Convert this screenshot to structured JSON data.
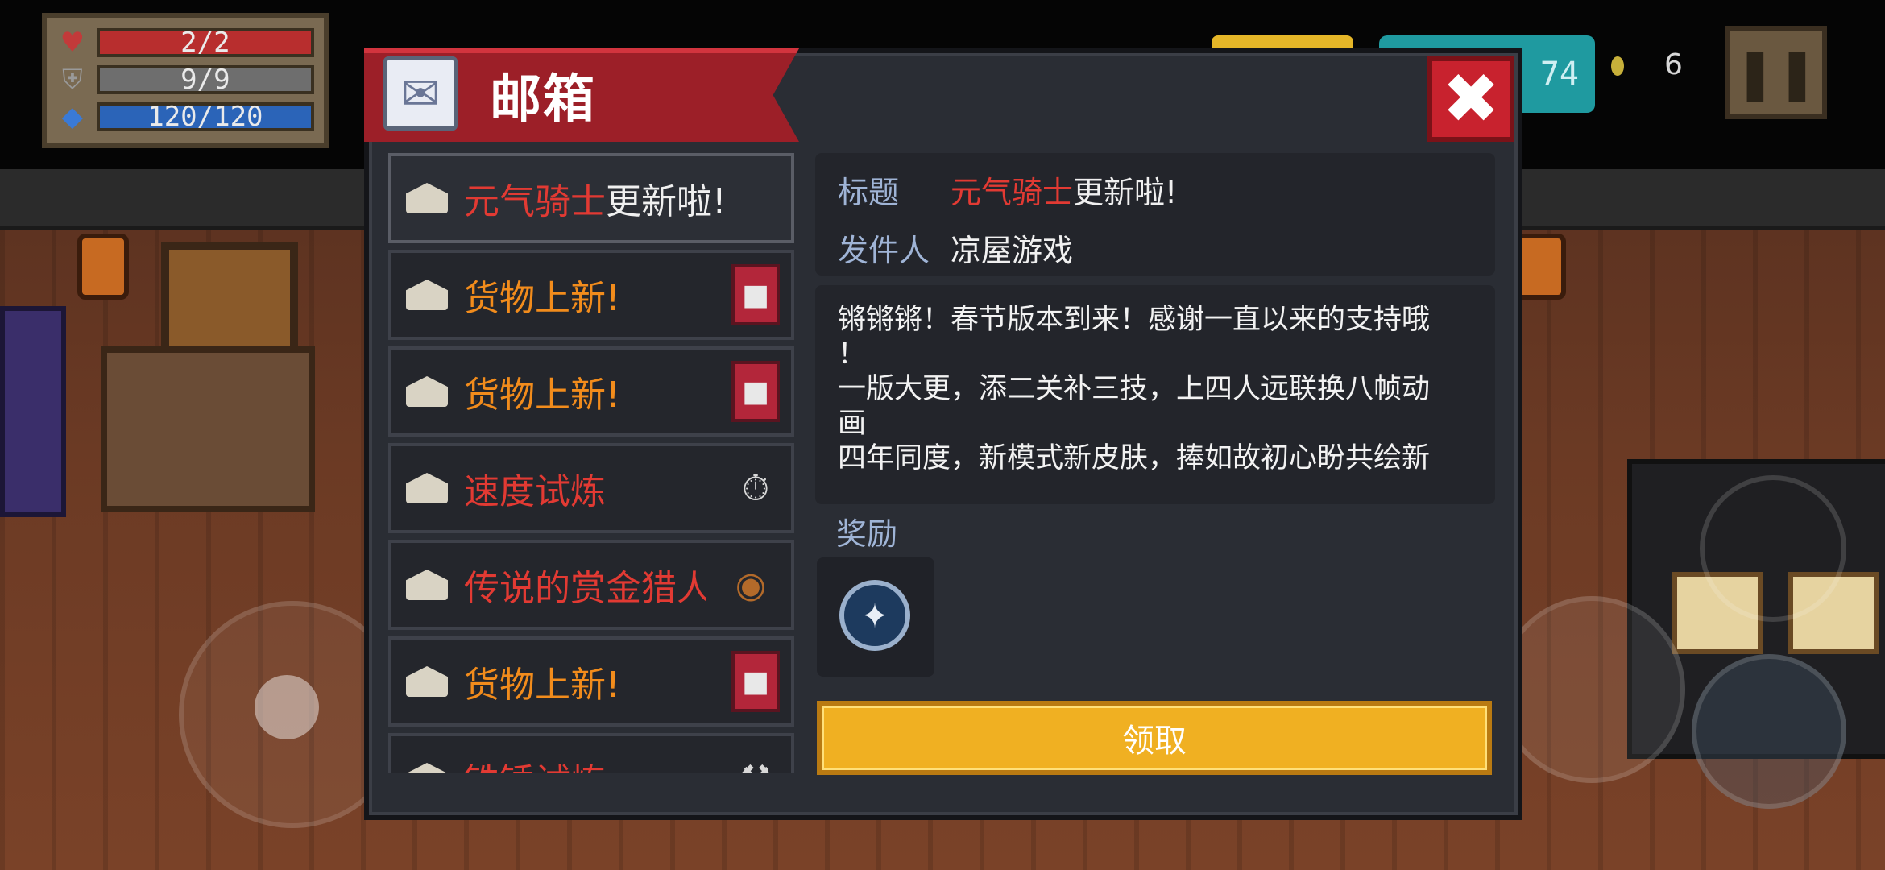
{
  "hud": {
    "hp": "2/2",
    "armor": "9/9",
    "energy": "120/120",
    "gems_partial": "74",
    "coins": "6",
    "hp_icon": "heart-icon",
    "armor_icon": "shield-icon",
    "energy_icon": "diamond-icon",
    "pause_icon": "pause-icon"
  },
  "mailbox": {
    "title": "邮箱",
    "close_icon": "close-icon",
    "mails": [
      {
        "title_highlight": "元气骑士",
        "title_rest": "更新啦!",
        "highlight_color": "red",
        "thumb": "",
        "selected": true
      },
      {
        "title_highlight": "货物上新!",
        "title_rest": "",
        "highlight_color": "orange",
        "thumb": "cat-merchant-icon"
      },
      {
        "title_highlight": "货物上新!",
        "title_rest": "",
        "highlight_color": "orange",
        "thumb": "cat-merchant-icon"
      },
      {
        "title_highlight": "速度试炼",
        "title_rest": "",
        "highlight_color": "red",
        "thumb": "stopwatch-icon"
      },
      {
        "title_highlight": "传说的赏金猎人",
        "title_rest": "",
        "highlight_color": "red",
        "thumb": "bounty-hunter-icon"
      },
      {
        "title_highlight": "货物上新!",
        "title_rest": "",
        "highlight_color": "orange",
        "thumb": "cat-merchant-icon"
      },
      {
        "title_highlight": "铁锤试炼",
        "title_rest": "",
        "highlight_color": "red",
        "thumb": "hammer-icon"
      }
    ],
    "detail": {
      "subject_label": "标题",
      "subject_highlight": "元气骑士",
      "subject_rest": "更新啦!",
      "sender_label": "发件人",
      "sender": "凉屋游戏",
      "body_line1": "锵锵锵！春节版本到来！感谢一直以来的支持哦",
      "body_line2": "！",
      "body_line3": "一版大更，添二关补三技，上四人远联换八帧动",
      "body_line4": "画",
      "body_line5": "四年同度，新模式新皮肤，捧如故初心盼共绘新",
      "reward_label": "奖励",
      "reward_icon": "fish-icon",
      "claim_label": "领取"
    }
  },
  "colors": {
    "banner": "#9c1f28",
    "highlight_red": "#e23a33",
    "highlight_orange": "#f28c1c",
    "claim": "#f0b022"
  }
}
